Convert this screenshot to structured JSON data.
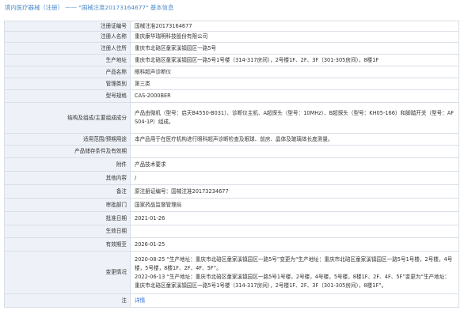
{
  "header": {
    "category": "境内医疗器械（注册）",
    "separator": "——",
    "reg_no_quoted": "\"国械注准20173164677\"",
    "suffix": "基本信息"
  },
  "rows": {
    "reg_no": {
      "label": "注册证编号",
      "value": "国械注准20173164677"
    },
    "registrant": {
      "label": "注册人名称",
      "value": "重庆康华瑞明科技股份有限公司"
    },
    "address": {
      "label": "注册人住所",
      "value": "重庆市北碚区童家溪镇园区一路5号"
    },
    "prod_addr": {
      "label": "生产地址",
      "value": "重庆市北碚区童家溪镇园区一路5号1号楼（314-317房间），2号楼1F、2F、3F（301-305房间），8楼1F"
    },
    "prod_name": {
      "label": "产品名称",
      "value": "眼科超声诊断仪"
    },
    "mgmt_class": {
      "label": "管理类别",
      "value": "第三类"
    },
    "model": {
      "label": "型号规格",
      "value": "CAS-2000BER"
    },
    "structure": {
      "label": "结构及组成/主要组成成分",
      "value": "产品由微机（型号：启天B4550-B031）、诊断仪主机、A超探头（型号：10MHz）、B超探头（型号：KH05-166）和脚踏开关（型号：AFS04-1P）组成。"
    },
    "scope": {
      "label": "适用范围/预期用途",
      "value": "本产品用于在医疗机构进行眼科超声诊断检查及眼球、前房、晶体及玻璃体长度测量。"
    },
    "storage": {
      "label": "产品储存条件及有效期",
      "value": ""
    },
    "attachment": {
      "label": "附件",
      "value": "产品技术要求"
    },
    "other": {
      "label": "其他内容",
      "value": "/"
    },
    "remark": {
      "label": "备注",
      "value": "原注册证编号：国械注准20173234677"
    },
    "approver": {
      "label": "审批部门",
      "value": "国家药品监督管理局"
    },
    "approve_date": {
      "label": "批准日期",
      "value": "2021-01-26"
    },
    "effect_date": {
      "label": "生效日期",
      "value": ""
    },
    "valid_until": {
      "label": "有效期至",
      "value": "2026-01-25"
    },
    "changes": {
      "label": "变更情况",
      "entry1": "2020-08-25 “生产地址：重庆市北碚区童家溪镇园区一路5号”变更为“生产地址：重庆市北碚区童家溪镇园区一路5号1号楼，2号楼，4号楼，5号楼，8楼1F、2F、4F、5F”。",
      "entry2": "2022-06-13 “生产地址：重庆市北碚区童家溪镇园区一路5号1号楼，2号楼，4号楼，5号楼，8楼1F、2F、4F、5F”变更为“生产地址：重庆市北碚区童家溪镇园区一路5号1号楼（314-317房间），2号楼1F、2F、3F（301-305房间），8楼1F”。"
    },
    "note": {
      "label": "注",
      "value": "详情"
    }
  }
}
